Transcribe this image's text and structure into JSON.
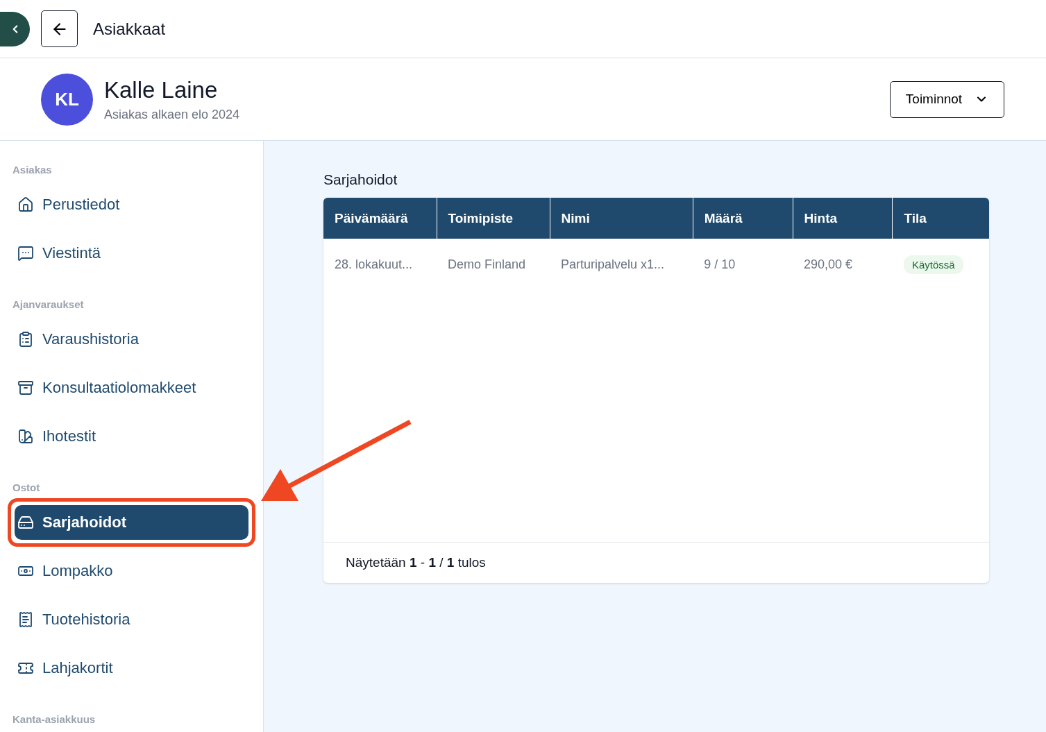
{
  "topbar": {
    "title": "Asiakkaat"
  },
  "customer": {
    "initials": "KL",
    "name": "Kalle Laine",
    "since": "Asiakas alkaen elo 2024",
    "actions_button": "Toiminnot"
  },
  "sidebar": {
    "sections": [
      {
        "heading": "Asiakas",
        "items": [
          {
            "label": "Perustiedot",
            "selected": false,
            "highlighted": false
          },
          {
            "label": "Viestintä",
            "selected": false,
            "highlighted": false
          }
        ]
      },
      {
        "heading": "Ajanvaraukset",
        "items": [
          {
            "label": "Varaushistoria",
            "selected": false,
            "highlighted": false
          },
          {
            "label": "Konsultaatiolomakkeet",
            "selected": false,
            "highlighted": false
          },
          {
            "label": "Ihotestit",
            "selected": false,
            "highlighted": false
          }
        ]
      },
      {
        "heading": "Ostot",
        "items": [
          {
            "label": "Sarjahoidot",
            "selected": true,
            "highlighted": true
          },
          {
            "label": "Lompakko",
            "selected": false,
            "highlighted": false
          },
          {
            "label": "Tuotehistoria",
            "selected": false,
            "highlighted": false
          },
          {
            "label": "Lahjakortit",
            "selected": false,
            "highlighted": false
          }
        ]
      },
      {
        "heading": "Kanta-asiakkuus"
      }
    ]
  },
  "content": {
    "title": "Sarjahoidot",
    "table": {
      "columns": [
        "Päivämäärä",
        "Toimipiste",
        "Nimi",
        "Määrä",
        "Hinta",
        "Tila"
      ],
      "rows": [
        {
          "cells": [
            "28. lokakuut...",
            "Demo Finland",
            "Parturipalvelu x1...",
            "9 / 10",
            "290,00 €"
          ],
          "status": "Käytössä"
        }
      ]
    },
    "footer": "Näytetään **1** - **1** / **1** tulos"
  }
}
